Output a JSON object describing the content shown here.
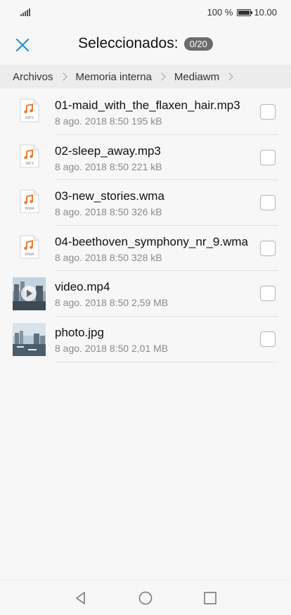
{
  "status_bar": {
    "battery_percent": "100 %",
    "time": "10.00",
    "battery_level": 1.0
  },
  "header": {
    "title": "Seleccionados:",
    "count": "0/20",
    "close_icon": "close-icon"
  },
  "breadcrumb": [
    "Archivos",
    "Memoria interna",
    "Mediawm"
  ],
  "files": [
    {
      "name": "01-maid_with_the_flaxen_hair.mp3",
      "date": "8 ago. 2018 8:50",
      "size": "195 kB",
      "icon": "music-file-icon",
      "type_label": "MP3",
      "checked": false
    },
    {
      "name": "02-sleep_away.mp3",
      "date": "8 ago. 2018 8:50",
      "size": "221 kB",
      "icon": "music-file-icon",
      "type_label": "MP3",
      "checked": false
    },
    {
      "name": "03-new_stories.wma",
      "date": "8 ago. 2018 8:50",
      "size": "326 kB",
      "icon": "music-file-icon",
      "type_label": "WMA",
      "checked": false
    },
    {
      "name": "04-beethoven_symphony_nr_9.wma",
      "date": "8 ago. 2018 8:50",
      "size": "328 kB",
      "icon": "music-file-icon",
      "type_label": "WMA",
      "checked": false
    },
    {
      "name": "video.mp4",
      "date": "8 ago. 2018 8:50",
      "size": "2,59 MB",
      "icon": "video-thumbnail",
      "type_label": "",
      "checked": false
    },
    {
      "name": "photo.jpg",
      "date": "8 ago. 2018 8:50",
      "size": "2,01 MB",
      "icon": "photo-thumbnail",
      "type_label": "",
      "checked": false
    }
  ],
  "nav": {
    "back": "back-icon",
    "home": "home-icon",
    "recents": "recents-icon"
  },
  "colors": {
    "accent": "#2a8fd8",
    "music_icon": "#f07a28",
    "badge": "#6b6b6b"
  }
}
